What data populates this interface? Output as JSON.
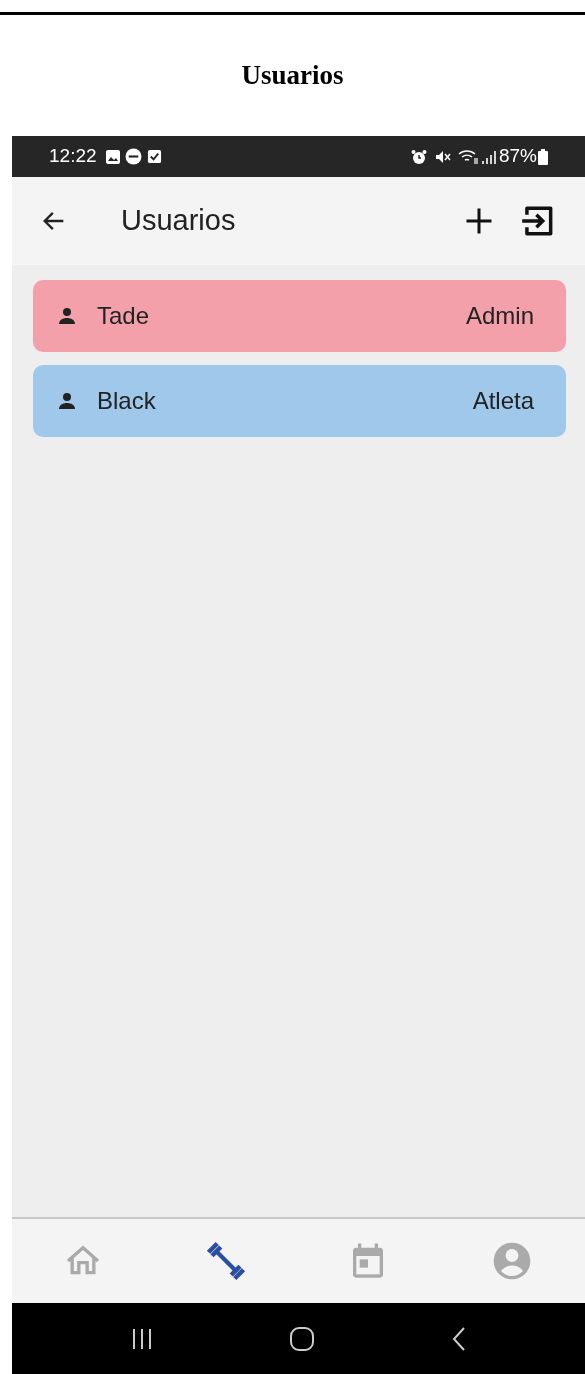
{
  "caption": "Usuarios",
  "status_bar": {
    "time": "12:22",
    "battery": "87%"
  },
  "app_bar": {
    "title": "Usuarios"
  },
  "users": [
    {
      "name": "Tade",
      "role": "Admin",
      "color": "#f4a0ab"
    },
    {
      "name": "Black",
      "role": "Atleta",
      "color": "#9fc8eb"
    }
  ],
  "bottom_nav": [
    {
      "kind": "home",
      "selected": false
    },
    {
      "kind": "workout",
      "selected": true
    },
    {
      "kind": "calendar",
      "selected": false
    },
    {
      "kind": "profile",
      "selected": false
    }
  ]
}
